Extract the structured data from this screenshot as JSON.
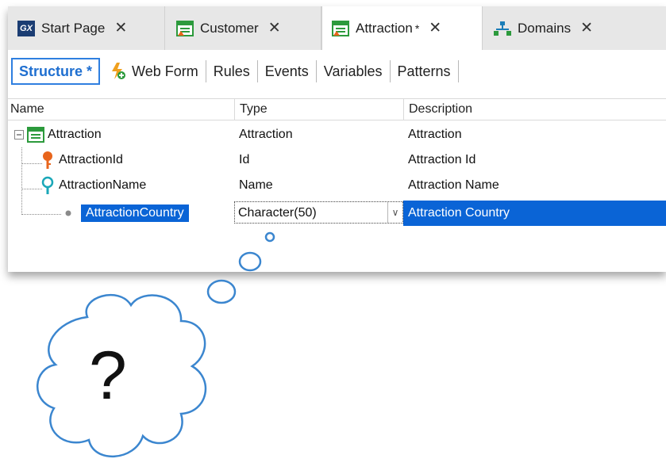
{
  "tabs": [
    {
      "label": "Start Page",
      "icon": "gx-icon"
    },
    {
      "label": "Customer",
      "icon": "transaction-icon"
    },
    {
      "label": "Attraction",
      "icon": "transaction-icon",
      "modified": "*"
    },
    {
      "label": "Domains",
      "icon": "domains-icon"
    }
  ],
  "subtabs": {
    "structure": "Structure *",
    "webform": "Web Form",
    "rules": "Rules",
    "events": "Events",
    "variables": "Variables",
    "patterns": "Patterns"
  },
  "columns": {
    "name": "Name",
    "type": "Type",
    "description": "Description"
  },
  "rows": [
    {
      "name": "Attraction",
      "type": "Attraction",
      "description": "Attraction",
      "icon": "transaction-icon"
    },
    {
      "name": "AttractionId",
      "type": "Id",
      "description": "Attraction Id",
      "icon": "key-icon"
    },
    {
      "name": "AttractionName",
      "type": "Name",
      "description": "Attraction Name",
      "icon": "search-key-icon"
    },
    {
      "name": "AttractionCountry",
      "type": "Character(50)",
      "description": "Attraction Country",
      "icon": "bullet-icon"
    }
  ],
  "bubble": {
    "text": "?"
  },
  "colors": {
    "accent": "#0a64d6",
    "bubble_outline": "#3b86cf",
    "key_orange": "#e8651c",
    "key_teal": "#1aa7b8"
  }
}
